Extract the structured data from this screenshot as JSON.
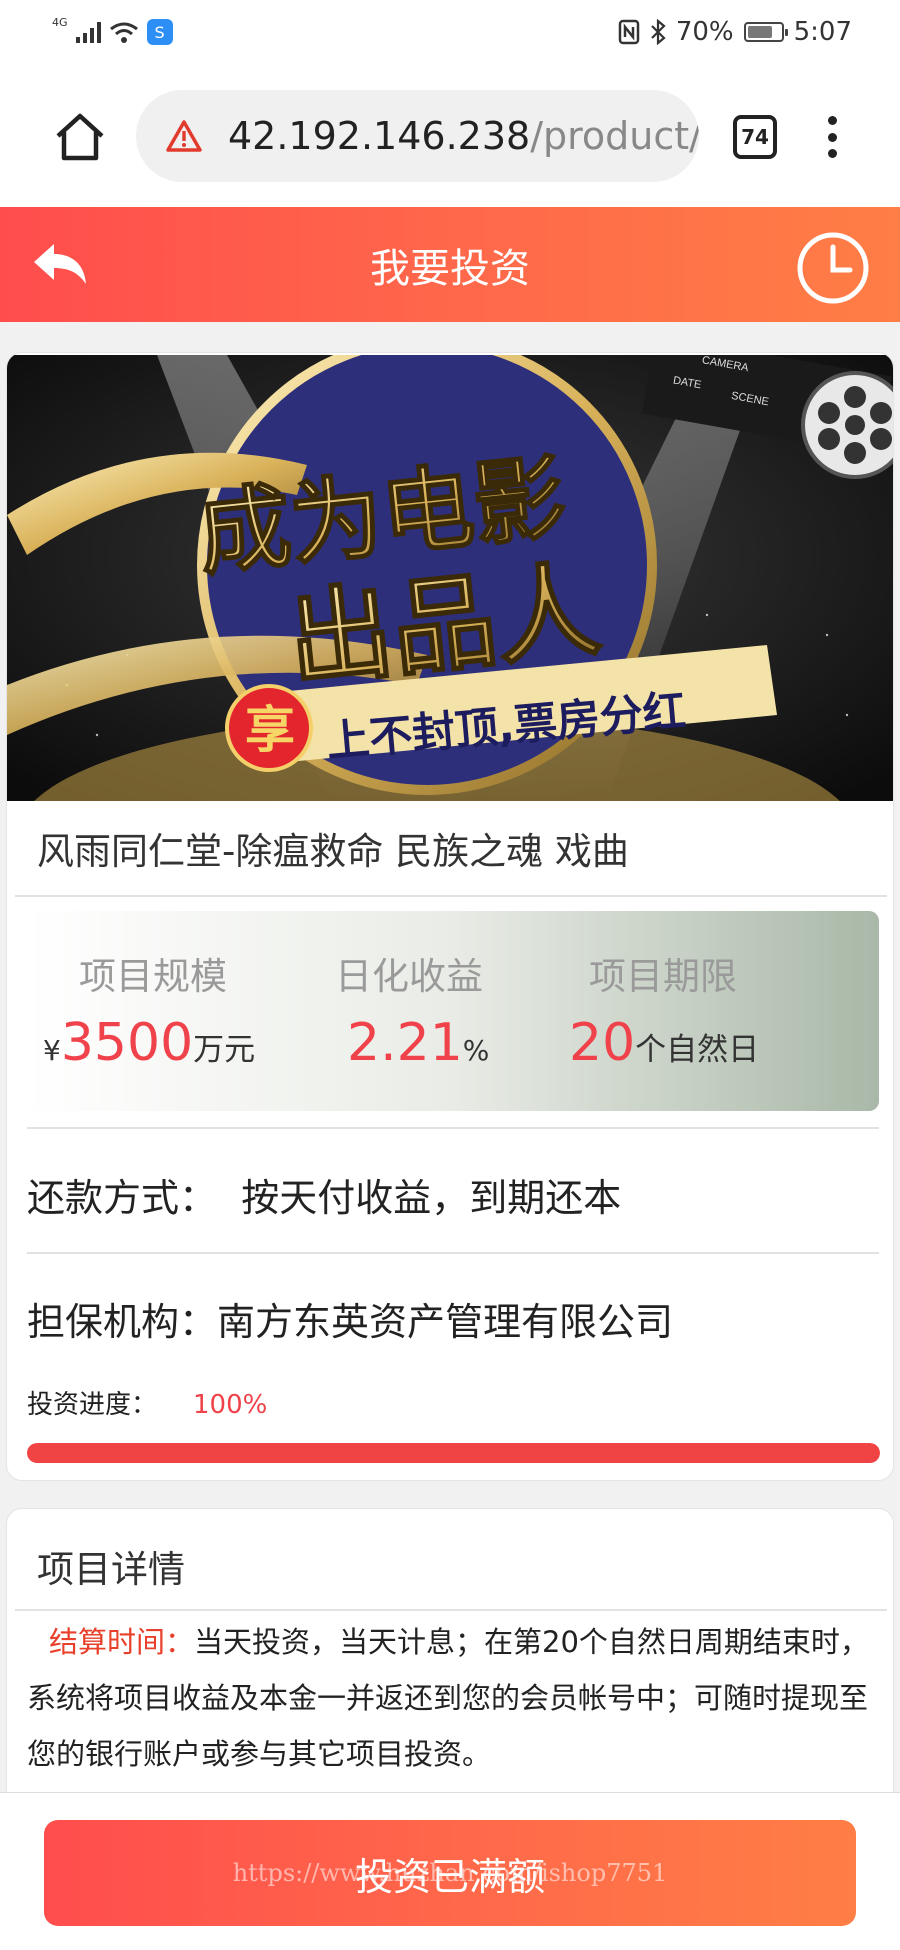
{
  "status_bar": {
    "network": "4G",
    "battery": "70%",
    "time": "5:07",
    "app_badge": "S"
  },
  "browser": {
    "url_host": "42.192.146.238",
    "url_path": "/product/",
    "tab_count": "74"
  },
  "header": {
    "title": "我要投资"
  },
  "product": {
    "banner": {
      "headline_1": "成为电影",
      "headline_2": "出品人",
      "badge": "享",
      "tagline": "上不封顶,票房分红",
      "clap_text_1": "CAMERA",
      "clap_text_2": "DATE",
      "clap_text_3": "SCENE"
    },
    "name": "风雨同仁堂-除瘟救命 民族之魂 戏曲",
    "stats": {
      "scale_label": "项目规模",
      "yield_label": "日化收益",
      "term_label": "项目期限",
      "scale_prefix": "¥",
      "scale_value": "3500",
      "scale_unit": "万元",
      "yield_value": "2.21",
      "yield_unit": "%",
      "term_value": "20",
      "term_unit": "个自然日"
    },
    "repayment_label": "还款方式：",
    "repayment_value": "按天付收益，到期还本",
    "guarantor_label": "担保机构：",
    "guarantor_value": "南方东英资产管理有限公司",
    "progress_label": "投资进度：",
    "progress_value": "100%",
    "progress_fraction": 1.0
  },
  "details": {
    "title": "项目详情",
    "settle_label": "结算时间：",
    "settle_text": "当天投资，当天计息；在第20个自然日周期结束时，系统将项目收益及本金一并返还到您的会员帐号中；可随时提现至您的银行账户或参与其它项目投资。"
  },
  "footer": {
    "button_label": "投资已满额",
    "watermark": "https://www.huzhan.com/ishop7751"
  },
  "colors": {
    "accent_red": "#f0424a",
    "header_gradient_start": "#ff4d4d",
    "header_gradient_end": "#ff7e45",
    "label_red": "#e8402b"
  }
}
